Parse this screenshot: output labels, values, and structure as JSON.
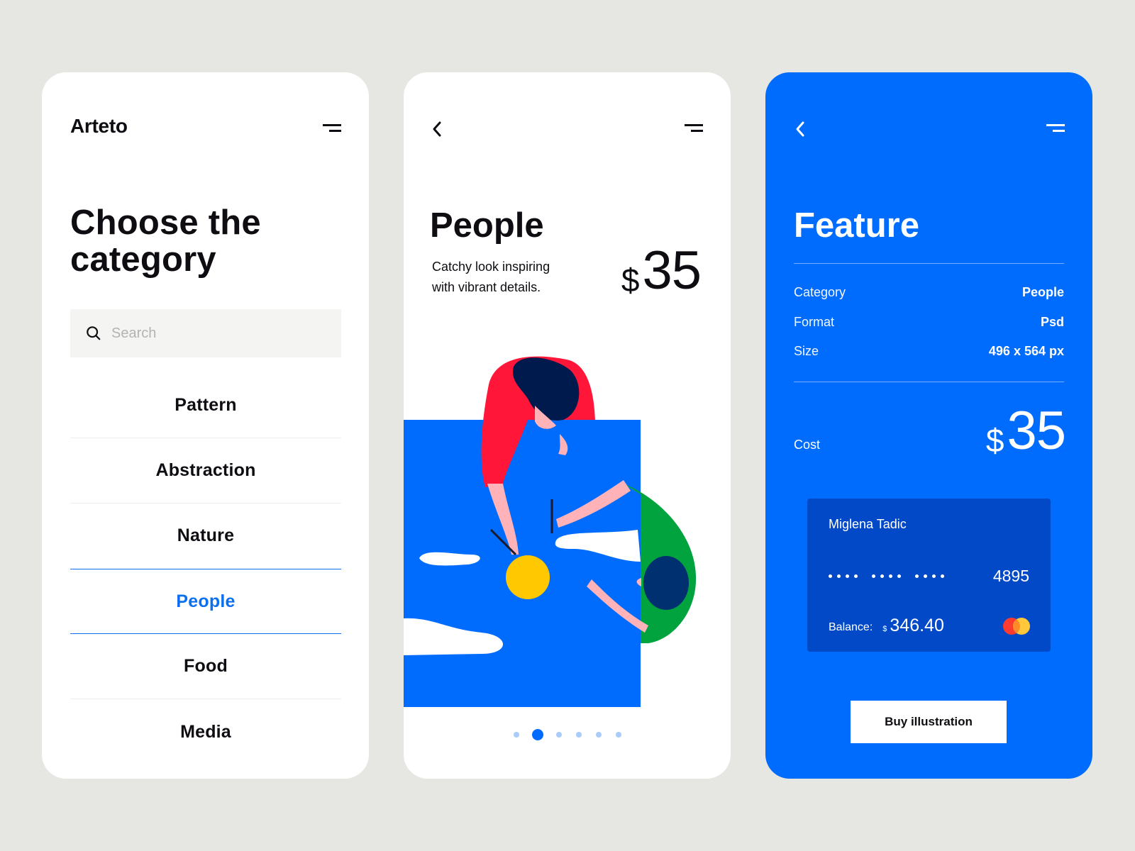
{
  "colors": {
    "background": "#e6e6e2",
    "accent": "#006cfd",
    "active_text": "#0a6ff0",
    "card_dark": "#0149c7",
    "text": "#0f0c12"
  },
  "categories_screen": {
    "brand": "Arteto",
    "title_line1": "Choose the",
    "title_line2": "category",
    "search": {
      "placeholder": "Search",
      "value": ""
    },
    "items": [
      {
        "label": "Pattern",
        "active": false
      },
      {
        "label": "Abstraction",
        "active": false
      },
      {
        "label": "Nature",
        "active": false
      },
      {
        "label": "People",
        "active": true
      },
      {
        "label": "Food",
        "active": false
      },
      {
        "label": "Media",
        "active": false
      }
    ]
  },
  "detail_screen": {
    "title": "People",
    "description_line1": "Catchy look inspiring",
    "description_line2": "with vibrant details.",
    "price_currency": "$",
    "price_amount": "35",
    "carousel": {
      "total": 6,
      "active_index": 1
    }
  },
  "feature_screen": {
    "title": "Feature",
    "specs": [
      {
        "key": "Category",
        "value": "People"
      },
      {
        "key": "Format",
        "value": "Psd"
      },
      {
        "key": "Size",
        "value": "496 x 564 px"
      }
    ],
    "cost_label": "Cost",
    "cost_currency": "$",
    "cost_amount": "35",
    "card": {
      "holder": "Miglena Tadic",
      "masked_groups": 3,
      "last4": "4895",
      "balance_label": "Balance:",
      "balance_currency": "$",
      "balance_amount": "346.40",
      "brand_icon": "mastercard-icon"
    },
    "buy_button": "Buy illustration"
  }
}
